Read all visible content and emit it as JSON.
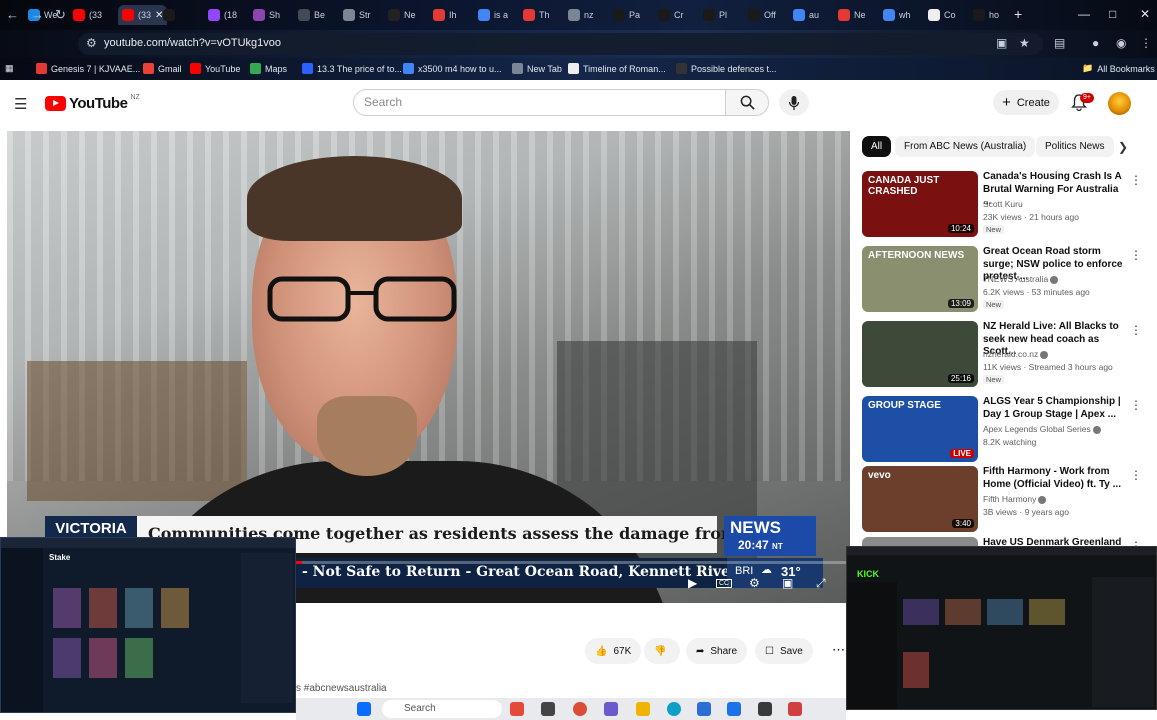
{
  "browser": {
    "tabs": [
      {
        "label": "We",
        "color": "#1e88e5"
      },
      {
        "label": "(33",
        "color": "#ff0000"
      },
      {
        "label": "(33",
        "color": "#ff0000"
      },
      {
        "label": "",
        "color": "#1a1a1a"
      },
      {
        "label": "(18",
        "color": "#9146ff"
      },
      {
        "label": "Sh",
        "color": "#8e44ad"
      },
      {
        "label": "Be",
        "color": "#444a55"
      },
      {
        "label": "Str",
        "color": "#7c8594"
      },
      {
        "label": "Ne",
        "color": "#222222"
      },
      {
        "label": "Ih",
        "color": "#e53935"
      },
      {
        "label": "is a",
        "color": "#4285f4"
      },
      {
        "label": "Th",
        "color": "#e53935"
      },
      {
        "label": "nz",
        "color": "#7c8594"
      },
      {
        "label": "Pa",
        "color": "#1a1a1a"
      },
      {
        "label": "Cr",
        "color": "#1a1a1a"
      },
      {
        "label": "Pl",
        "color": "#1a1a1a"
      },
      {
        "label": "Off",
        "color": "#1a1a1a"
      },
      {
        "label": "au",
        "color": "#4285f4"
      },
      {
        "label": "Ne",
        "color": "#e53935"
      },
      {
        "label": "wh",
        "color": "#4285f4"
      },
      {
        "label": "Co",
        "color": "#eeeeee"
      },
      {
        "label": "ho",
        "color": "#1a1a1a"
      }
    ],
    "url": "youtube.com/watch?v=vOTUkg1voo",
    "bookmarks": [
      {
        "label": "Genesis 7 | KJVAAE...",
        "color": "#e53935"
      },
      {
        "label": "Gmail",
        "color": "#ea4335"
      },
      {
        "label": "YouTube",
        "color": "#ff0000"
      },
      {
        "label": "Maps",
        "color": "#34a853"
      },
      {
        "label": "13.3 The price of to...",
        "color": "#2962ff"
      },
      {
        "label": "x3500 m4 how to u...",
        "color": "#4285f4"
      },
      {
        "label": "New Tab",
        "color": "#7c8594"
      },
      {
        "label": "Timeline of Roman...",
        "color": "#eeeeee"
      },
      {
        "label": "Possible defences t...",
        "color": "#333333"
      }
    ],
    "all_bookmarks": "All Bookmarks"
  },
  "youtube": {
    "logo_text": "YouTube",
    "region": "NZ",
    "search_placeholder": "Search",
    "create_label": "Create",
    "notification_count": "9+"
  },
  "player": {
    "region_tag": "VICTORIA",
    "headline": "Communities come together as residents assess the damage from fires",
    "network": "NEWS",
    "network_time": "20:47",
    "network_tz": "NT",
    "ticker": "- Not Safe to Return - Great Ocean Road, Kennett River to Lorne",
    "weather_city": "BRI",
    "weather_temp": "31°",
    "progress": 0.35
  },
  "actions": {
    "likes": "67K",
    "share": "Share",
    "save": "Save",
    "hashtags": "s #abcnewsaustralia"
  },
  "chips": [
    "All",
    "From ABC News (Australia)",
    "Politics News"
  ],
  "recommendations": [
    {
      "title": "Canada's Housing Crash Is A Brutal Warning For Australia ...",
      "channel": "Scott Kuru",
      "verified": false,
      "meta": "23K views · 21 hours ago",
      "badge": "New",
      "duration": "10:24",
      "thumb_text": "CANADA JUST CRASHED",
      "thumb_bg": "#7a1010"
    },
    {
      "title": "Great Ocean Road storm surge; NSW police to enforce protest ...",
      "channel": "7NEWS Australia",
      "verified": true,
      "meta": "6.2K views · 53 minutes ago",
      "badge": "New",
      "duration": "13:09",
      "thumb_text": "AFTERNOON NEWS",
      "thumb_bg": "#8a8f6f"
    },
    {
      "title": "NZ Herald Live: All Blacks to seek new head coach as Scott...",
      "channel": "nzherald.co.nz",
      "verified": true,
      "meta": "11K views · Streamed 3 hours ago",
      "badge": "New",
      "duration": "25:16",
      "thumb_text": "",
      "thumb_bg": "#3d4a3a"
    },
    {
      "title": "ALGS Year 5 Championship | Day 1 Group Stage | Apex ...",
      "channel": "Apex Legends Global Series",
      "verified": true,
      "meta": "8.2K watching",
      "badge": "",
      "duration": "LIVE",
      "thumb_text": "GROUP STAGE",
      "thumb_bg": "#1e4fa6"
    },
    {
      "title": "Fifth Harmony - Work from Home (Official Video) ft. Ty ...",
      "channel": "Fifth Harmony",
      "verified": true,
      "meta": "3B views · 9 years ago",
      "badge": "",
      "duration": "3:40",
      "thumb_text": "vevo",
      "thumb_bg": "#6b3f2c"
    },
    {
      "title": "Have US Denmark Greenland",
      "channel": "",
      "verified": false,
      "meta": "",
      "badge": "",
      "duration": "",
      "thumb_text": "",
      "thumb_bg": "#8a8a8a"
    }
  ],
  "taskbar": {
    "search_placeholder": "Search"
  },
  "overlays": {
    "left_app": "Stake",
    "right_app": "KICK"
  }
}
